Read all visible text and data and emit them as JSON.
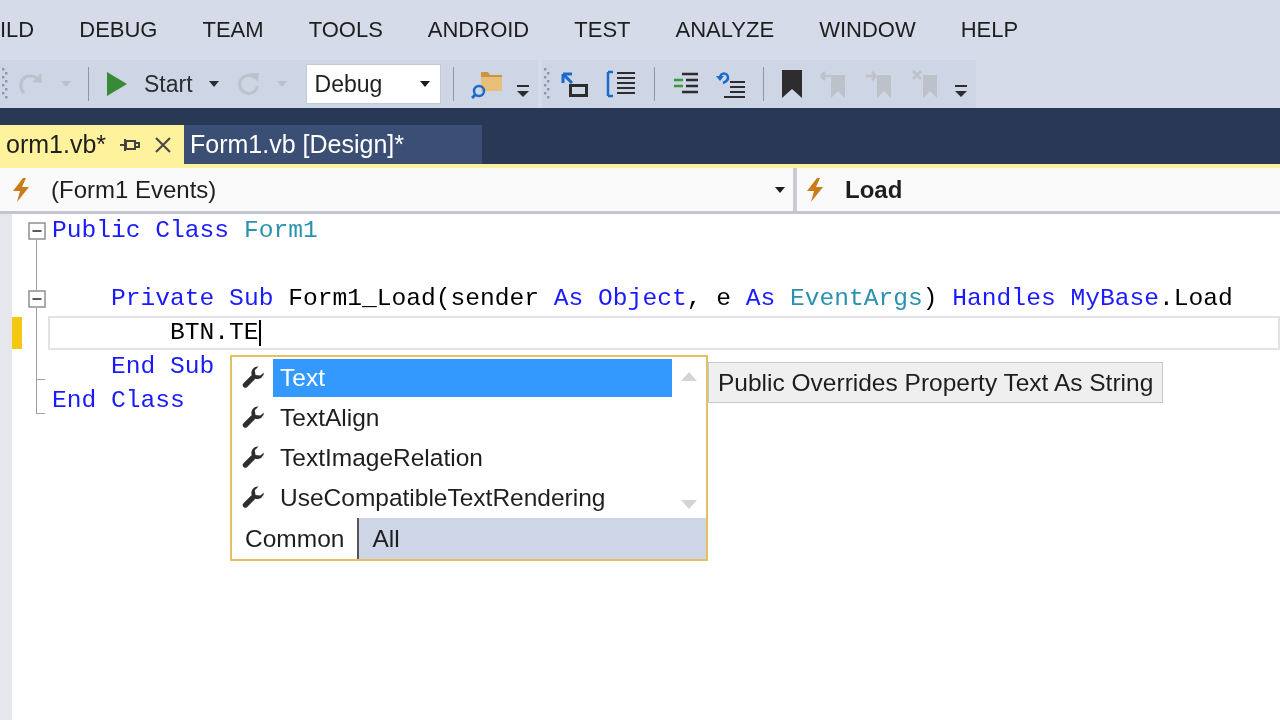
{
  "menu_bar": [
    "ILD",
    "DEBUG",
    "TEAM",
    "TOOLS",
    "ANDROID",
    "TEST",
    "ANALYZE",
    "WINDOW",
    "HELP"
  ],
  "toolbars": [
    {
      "groups": [
        [
          {
            "kind": "redo",
            "disabled": true
          },
          {
            "kind": "caret",
            "disabled": true
          }
        ],
        [
          {
            "kind": "start",
            "label": "Start",
            "disabled": false
          },
          {
            "kind": "caret",
            "disabled": false
          },
          {
            "kind": "restart",
            "disabled": true
          },
          {
            "kind": "caret",
            "disabled": true
          },
          {
            "kind": "combo",
            "value": "Debug",
            "disabled": false
          }
        ],
        [
          {
            "kind": "find",
            "disabled": false
          }
        ]
      ]
    },
    {
      "groups": [
        [
          {
            "kind": "members",
            "disabled": false
          },
          {
            "kind": "params",
            "disabled": false
          }
        ],
        [
          {
            "kind": "indent",
            "disabled": false
          },
          {
            "kind": "outdent",
            "disabled": false
          }
        ],
        [
          {
            "kind": "bookmark",
            "disabled": false
          },
          {
            "kind": "prevmark",
            "disabled": true
          },
          {
            "kind": "nextmark",
            "disabled": true
          },
          {
            "kind": "clearmark",
            "disabled": true
          }
        ]
      ]
    }
  ],
  "document_tabs": [
    {
      "label": "orm1.vb*",
      "selected": true
    },
    {
      "label": "Form1.vb [Design]*",
      "selected": false
    }
  ],
  "navigation_bar": {
    "type_dropdown": "(Form1 Events)",
    "member_dropdown": "Load"
  },
  "editor": {
    "lines": [
      {
        "kind": "region",
        "expanded": true,
        "current": false,
        "modified": false,
        "tokens": [
          {
            "kind": "keyword",
            "text": "Public"
          },
          {
            "kind": "keyword",
            "text": " Class"
          },
          {
            "kind": "type",
            "text": " Form1"
          }
        ],
        "children": [
          {
            "kind": "blank",
            "current": false,
            "modified": false
          },
          {
            "kind": "region",
            "expanded": true,
            "current": false,
            "modified": false,
            "tokens": [
              {
                "kind": "keyword",
                "text": "    Private"
              },
              {
                "kind": "keyword",
                "text": " Sub"
              },
              {
                "kind": "plain",
                "text": " Form1_Load(sender"
              },
              {
                "kind": "keyword",
                "text": " As"
              },
              {
                "kind": "keyword",
                "text": " Object"
              },
              {
                "kind": "plain",
                "text": ", e"
              },
              {
                "kind": "keyword",
                "text": " As"
              },
              {
                "kind": "type",
                "text": " EventArgs"
              },
              {
                "kind": "plain",
                "text": ")"
              },
              {
                "kind": "keyword",
                "text": " Handles"
              },
              {
                "kind": "keyword",
                "text": " MyBase"
              },
              {
                "kind": "plain",
                "text": ".Load"
              }
            ],
            "children": [
              {
                "kind": "code",
                "current": true,
                "modified": true,
                "tokens": [
                  {
                    "kind": "plain",
                    "text": "        BTN.TE"
                  }
                ]
              }
            ],
            "end": {
              "current": false,
              "modified": false,
              "tokens": [
                {
                  "kind": "keyword",
                  "text": "    End Sub"
                }
              ]
            }
          }
        ],
        "end": {
          "current": false,
          "modified": false,
          "tokens": [
            {
              "kind": "keyword",
              "text": "End Class"
            }
          ]
        }
      }
    ]
  },
  "completion_list": {
    "items": [
      {
        "label": "Text",
        "selected": true
      },
      {
        "label": "TextAlign",
        "selected": false
      },
      {
        "label": "TextImageRelation",
        "selected": false
      },
      {
        "label": "UseCompatibleTextRendering",
        "selected": false
      }
    ],
    "tabs": [
      {
        "label": "Common",
        "selected": false
      },
      {
        "label": "All",
        "selected": true
      }
    ]
  },
  "quick_info": "Public Overrides Property Text As String"
}
